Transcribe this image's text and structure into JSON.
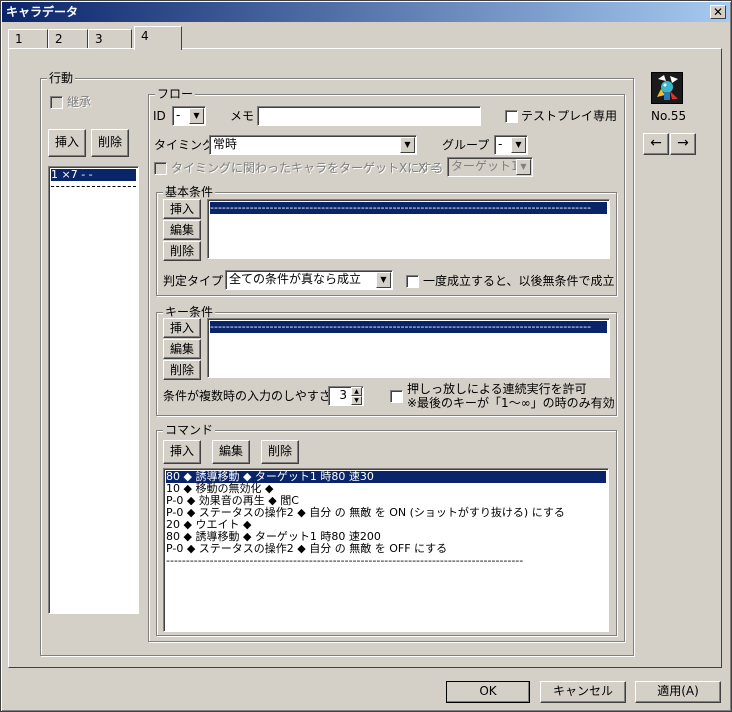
{
  "window": {
    "title": "キャラデータ",
    "close_glyph": "✕"
  },
  "tabs": [
    {
      "label": "1"
    },
    {
      "label": "2"
    },
    {
      "label": "3"
    },
    {
      "label": "4"
    }
  ],
  "action": {
    "group_label": "行動",
    "inherit_label": "継承",
    "insert_label": "挿入",
    "delete_label": "削除",
    "list": [
      "1 ×7 - -",
      "--------------------"
    ]
  },
  "flow": {
    "group_label": "フロー",
    "id_label": "ID",
    "id_value": "-",
    "memo_label": "メモ",
    "memo_value": "",
    "testplay_label": "テストプレイ専用",
    "timing_label": "タイミング",
    "timing_value": "常時",
    "group_field_label": "グループ",
    "group_value": "-",
    "target_label": "タイミングに関わったキャラをターゲットXにする",
    "x_label": "X =",
    "x_value": "ターゲット1"
  },
  "basic": {
    "group_label": "基本条件",
    "insert_label": "挿入",
    "edit_label": "編集",
    "delete_label": "削除",
    "list_first": "------------------------------------------------------------------------------------------------",
    "judge_label": "判定タイプ",
    "judge_value": "全ての条件が真なら成立",
    "once_label": "一度成立すると、以後無条件で成立"
  },
  "key": {
    "group_label": "キー条件",
    "insert_label": "挿入",
    "edit_label": "編集",
    "delete_label": "削除",
    "list_first": "------------------------------------------------------------------------------------------------",
    "ease_label": "条件が複数時の入力のしやすさ",
    "ease_value": "3",
    "hold_label": "押しっ放しによる連続実行を許可",
    "hold_note": "※最後のキーが「1～∞」の時のみ有効"
  },
  "command": {
    "group_label": "コマンド",
    "insert_label": "挿入",
    "edit_label": "編集",
    "delete_label": "削除",
    "lines": [
      "80 ◆ 誘導移動 ◆ ターゲット1 時80 速30",
      "10 ◆ 移動の無効化 ◆",
      "P-0 ◆ 効果音の再生 ◆ 閻C",
      "P-0 ◆ ステータスの操作2 ◆ 自分 の 無敵 を ON (ショットがすり抜ける) にする",
      "20 ◆ ウエイト ◆",
      "80 ◆ 誘導移動 ◆ ターゲット1 時80 速200",
      "P-0 ◆ ステータスの操作2 ◆ 自分 の 無敵 を OFF にする"
    ],
    "tail_line": "------------------------------------------------------------------------------------------"
  },
  "character": {
    "icon": "character-sprite-icon",
    "number": "No.55",
    "prev_glyph": "←",
    "next_glyph": "→"
  },
  "footer": {
    "ok_label": "OK",
    "cancel_label": "キャンセル",
    "apply_label": "適用(A)"
  },
  "colors": {
    "titlebar_start": "#0a246a",
    "titlebar_end": "#a6caf0",
    "selection": "#0a246a",
    "face": "#d4d0c8"
  }
}
